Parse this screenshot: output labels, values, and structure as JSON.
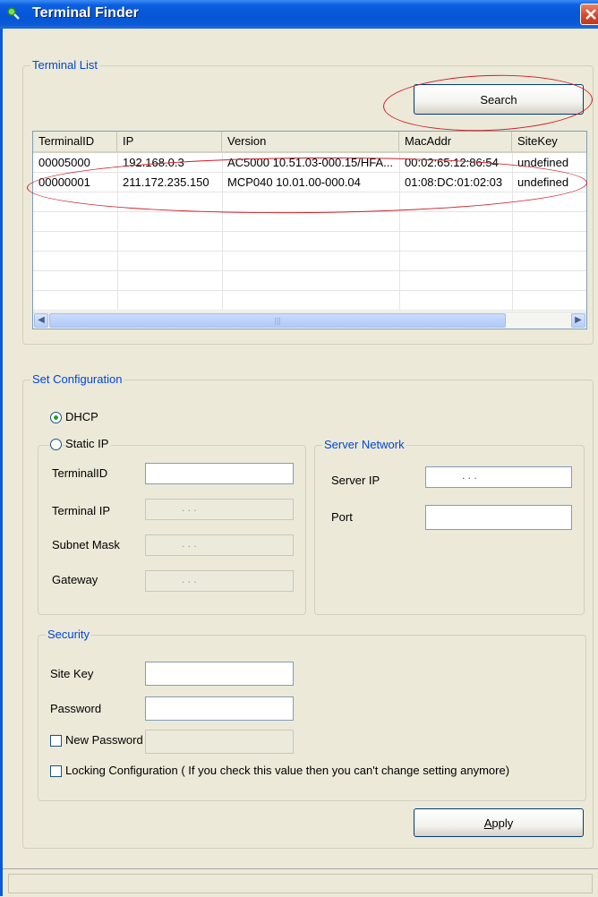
{
  "window": {
    "title": "Terminal Finder"
  },
  "terminal_list": {
    "legend": "Terminal List",
    "search_label": "Search",
    "columns": [
      "TerminalID",
      "IP",
      "Version",
      "MacAddr",
      "SiteKey"
    ],
    "rows": [
      [
        "00005000",
        "192.168.0.3",
        "AC5000 10.51.03-000.15/HFA...",
        "00:02:65:12:86:54",
        "undefined"
      ],
      [
        "00000001",
        "211.172.235.150",
        "MCP040 10.01.00-000.04",
        "01:08:DC:01:02:03",
        "undefined"
      ]
    ]
  },
  "config": {
    "legend": "Set Configuration",
    "dhcp_label": "DHCP",
    "static_ip_label": "Static IP",
    "terminal_id_label": "TerminalID",
    "terminal_ip_label": "Terminal IP",
    "subnet_mask_label": "Subnet Mask",
    "gateway_label": "Gateway",
    "ip_dots": ".        .        .",
    "server_network": {
      "legend": "Server Network",
      "server_ip_label": "Server IP",
      "port_label": "Port"
    },
    "security": {
      "legend": "Security",
      "site_key_label": "Site Key",
      "password_label": "Password",
      "new_password_label": "New Password",
      "locking_label": "Locking Configuration ( If you check this value then you can't  change setting anymore)"
    },
    "apply_label": "Apply"
  },
  "colors": {
    "annotation": "#cc1f2a",
    "legend_text": "#0046d5"
  }
}
